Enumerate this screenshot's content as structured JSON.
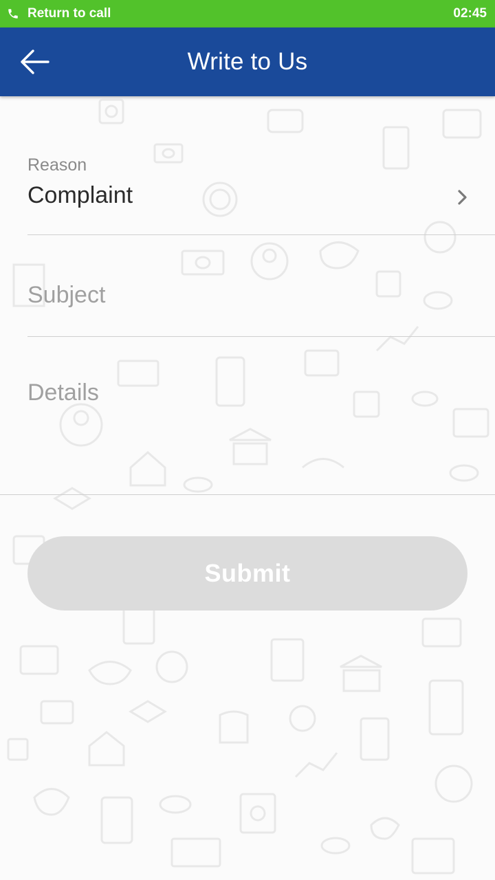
{
  "status_bar": {
    "call_text": "Return to call",
    "time": "02:45",
    "icon": "phone-icon",
    "color": "#52c22b"
  },
  "app_bar": {
    "title": "Write to Us",
    "back_icon": "arrow-left-icon",
    "color": "#1a4a9a"
  },
  "form": {
    "reason": {
      "label": "Reason",
      "value": "Complaint",
      "icon": "chevron-right-icon"
    },
    "subject": {
      "placeholder": "Subject"
    },
    "details": {
      "placeholder": "Details"
    },
    "submit_label": "Submit",
    "submit_color": "#dcdcdc"
  }
}
